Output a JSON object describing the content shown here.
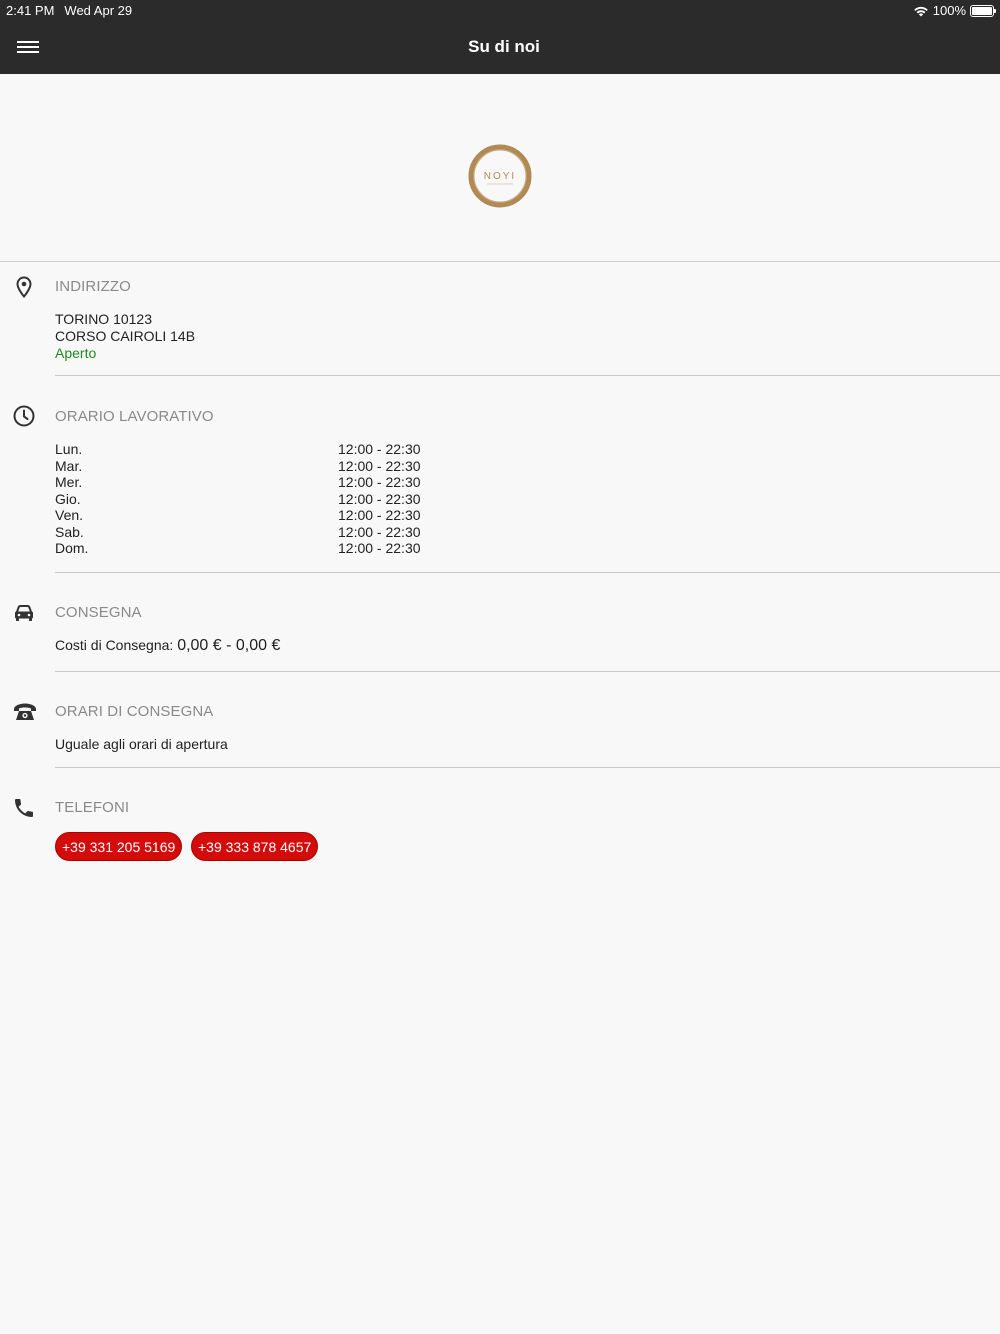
{
  "status_bar": {
    "time": "2:41 PM",
    "date": "Wed Apr 29",
    "battery": "100%"
  },
  "header": {
    "title": "Su di noi"
  },
  "logo": {
    "text": "NOYI",
    "brand_color": "#b08a55"
  },
  "address": {
    "title": "INDIRIZZO",
    "line1": "TORINO 10123",
    "line2": "CORSO CAIROLI 14B",
    "status": "Aperto",
    "status_color": "#1f8a1f"
  },
  "working_hours": {
    "title": "ORARIO LAVORATIVO",
    "rows": [
      {
        "day": "Lun.",
        "time": "12:00 - 22:30"
      },
      {
        "day": "Mar.",
        "time": "12:00 - 22:30"
      },
      {
        "day": "Mer.",
        "time": "12:00 - 22:30"
      },
      {
        "day": "Gio.",
        "time": "12:00 - 22:30"
      },
      {
        "day": "Ven.",
        "time": "12:00 - 22:30"
      },
      {
        "day": "Sab.",
        "time": "12:00 - 22:30"
      },
      {
        "day": "Dom.",
        "time": "12:00 - 22:30"
      }
    ]
  },
  "delivery": {
    "title": "CONSEGNA",
    "cost_label": "Costi di Consegna:",
    "cost_value": "0,00 € - 0,00 €"
  },
  "delivery_hours": {
    "title": "ORARI DI CONSEGNA",
    "text": "Uguale agli orari di apertura"
  },
  "phones": {
    "title": "TELEFONI",
    "numbers": [
      "+39 331 205 5169",
      "+39 333 878 4657"
    ],
    "button_color": "#d30b0b"
  }
}
